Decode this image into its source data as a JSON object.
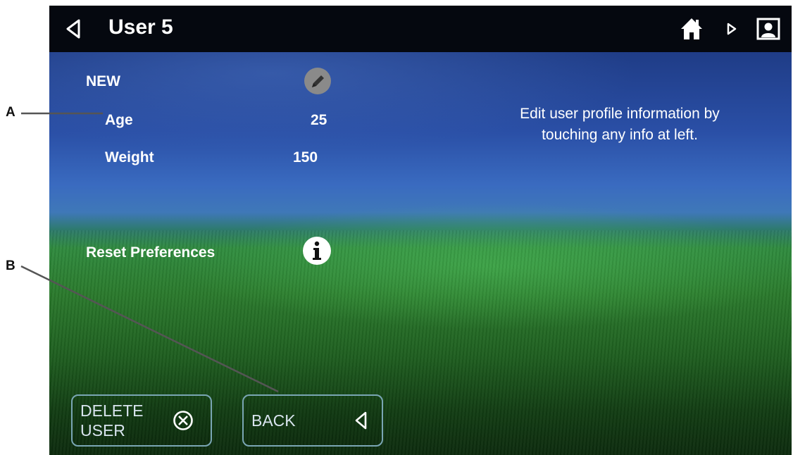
{
  "callouts": {
    "a": "A",
    "b": "B"
  },
  "header": {
    "title": "User 5",
    "back_icon": "chevron-left-icon",
    "home_icon": "home-icon",
    "play_icon": "play-icon",
    "profile_icon": "profile-icon"
  },
  "profile": {
    "new_label": "NEW",
    "age_label": "Age",
    "age_value": "25",
    "weight_label": "Weight",
    "weight_value": "150",
    "reset_label": "Reset Preferences",
    "edit_icon": "pencil-icon",
    "info_icon": "info-icon"
  },
  "help": {
    "line1": "Edit user profile information by",
    "line2": "touching any info at left."
  },
  "buttons": {
    "delete_line1": "DELETE",
    "delete_line2": "USER",
    "delete_icon": "circle-x-icon",
    "back_label": "BACK",
    "back_icon": "chevron-left-icon"
  },
  "colors": {
    "topbar": "#05080f",
    "button_border": "#7aa6b4",
    "sky": "#2a4fa6",
    "grass": "#2a7a2c"
  }
}
